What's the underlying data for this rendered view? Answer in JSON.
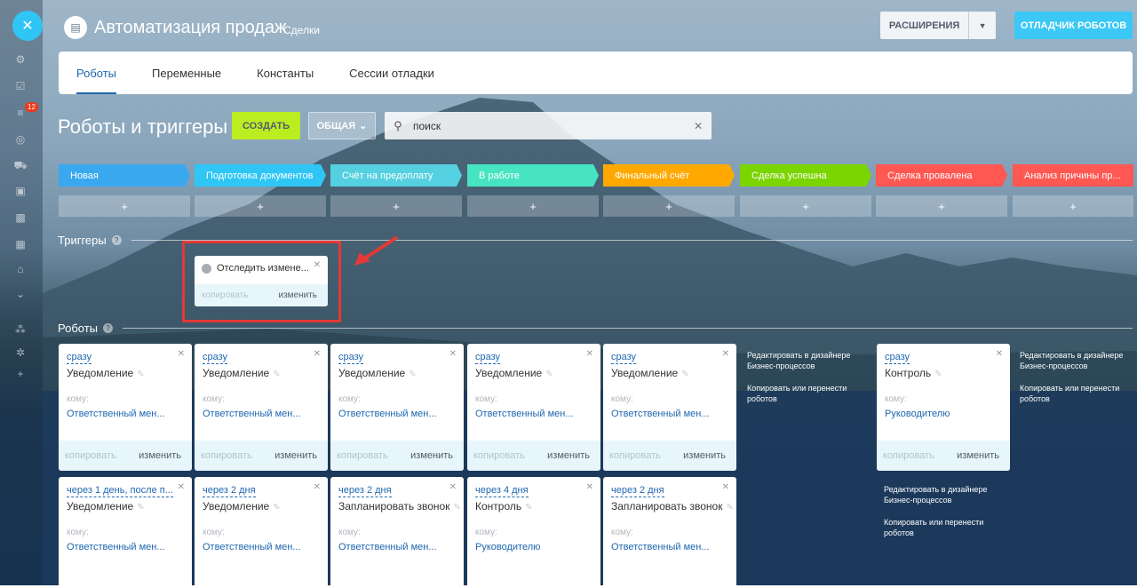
{
  "header": {
    "title": "Автоматизация продаж",
    "subtitle": "Сделки",
    "extensions_label": "РАСШИРЕНИЯ",
    "debugger_label": "ОТЛАДЧИК РОБОТОВ"
  },
  "rail": {
    "badge": "12"
  },
  "tabs": [
    {
      "label": "Роботы",
      "active": true
    },
    {
      "label": "Переменные"
    },
    {
      "label": "Константы"
    },
    {
      "label": "Сессии отладки"
    }
  ],
  "toolbar": {
    "title": "Роботы и триггеры",
    "create_label": "СОЗДАТЬ",
    "general_label": "ОБЩАЯ",
    "search_value": "поиск"
  },
  "stages": [
    {
      "label": "Новая",
      "color": "#39a8ef"
    },
    {
      "label": "Подготовка документов",
      "color": "#2fc6f6"
    },
    {
      "label": "Счёт на предоплату",
      "color": "#55d0e0"
    },
    {
      "label": "В работе",
      "color": "#47e4c2"
    },
    {
      "label": "Финальный счёт",
      "color": "#ffa900"
    },
    {
      "label": "Сделка успешна",
      "color": "#7bd500"
    },
    {
      "label": "Сделка провалена",
      "color": "#ff5752"
    },
    {
      "label": "Анализ причины пр...",
      "color": "#ff5752"
    }
  ],
  "add_symbol": "+",
  "triggers": {
    "section_title": "Триггеры",
    "help": "?",
    "item": {
      "label": "Отследить измене...",
      "copy": "копировать",
      "edit": "изменить"
    }
  },
  "robots": {
    "section_title": "Роботы",
    "help": "?",
    "to_label": "кому:",
    "copy": "копировать",
    "edit": "изменить",
    "row1": [
      {
        "when": "сразу",
        "name": "Уведомление",
        "to": "Ответственный мен..."
      },
      {
        "when": "сразу",
        "name": "Уведомление",
        "to": "Ответственный мен..."
      },
      {
        "when": "сразу",
        "name": "Уведомление",
        "to": "Ответственный мен..."
      },
      {
        "when": "сразу",
        "name": "Уведомление",
        "to": "Ответственный мен..."
      },
      {
        "when": "сразу",
        "name": "Уведомление",
        "to": "Ответственный мен..."
      },
      {
        "when": "сразу",
        "name": "Контроль",
        "to": "Руководителю"
      }
    ],
    "row2": [
      {
        "when": "через 1 день, после п...",
        "name": "Уведомление",
        "to": "Ответственный мен..."
      },
      {
        "when": "через 2 дня",
        "name": "Уведомление",
        "to": "Ответственный мен..."
      },
      {
        "when": "через 2 дня",
        "name": "Запланировать звонок",
        "to": "Ответственный мен..."
      },
      {
        "when": "через 4 дня",
        "name": "Контроль",
        "to": "Руководителю"
      },
      {
        "when": "через 2 дня",
        "name": "Запланировать звонок",
        "to": "Ответственный мен..."
      }
    ],
    "side_links": {
      "edit_designer": "Редактировать в дизайнере Бизнес-процессов",
      "copy_move": "Копировать или перенести роботов"
    }
  }
}
